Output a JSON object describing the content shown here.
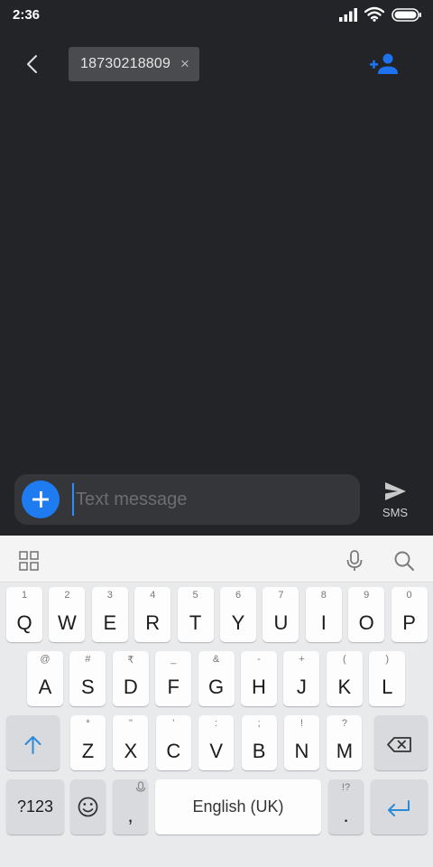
{
  "status_bar": {
    "time": "2:36"
  },
  "header": {
    "recipient": "18730218809"
  },
  "compose": {
    "placeholder": "Text message",
    "send_label": "SMS"
  },
  "keyboard": {
    "row1": [
      {
        "hint": "1",
        "key": "Q"
      },
      {
        "hint": "2",
        "key": "W"
      },
      {
        "hint": "3",
        "key": "E"
      },
      {
        "hint": "4",
        "key": "R"
      },
      {
        "hint": "5",
        "key": "T"
      },
      {
        "hint": "6",
        "key": "Y"
      },
      {
        "hint": "7",
        "key": "U"
      },
      {
        "hint": "8",
        "key": "I"
      },
      {
        "hint": "9",
        "key": "O"
      },
      {
        "hint": "0",
        "key": "P"
      }
    ],
    "row2": [
      {
        "hint": "@",
        "key": "A"
      },
      {
        "hint": "#",
        "key": "S"
      },
      {
        "hint": "₹",
        "key": "D"
      },
      {
        "hint": "_",
        "key": "F"
      },
      {
        "hint": "&",
        "key": "G"
      },
      {
        "hint": "-",
        "key": "H"
      },
      {
        "hint": "+",
        "key": "J"
      },
      {
        "hint": "(",
        "key": "K"
      },
      {
        "hint": ")",
        "key": "L"
      }
    ],
    "row3": [
      {
        "hint": "*",
        "key": "Z"
      },
      {
        "hint": "\"",
        "key": "X"
      },
      {
        "hint": "'",
        "key": "C"
      },
      {
        "hint": ":",
        "key": "V"
      },
      {
        "hint": ";",
        "key": "B"
      },
      {
        "hint": "!",
        "key": "N"
      },
      {
        "hint": "?",
        "key": "M"
      }
    ],
    "symbols_label": "?123",
    "comma": ",",
    "space_label": "English (UK)",
    "period_hint": "!?",
    "period": "."
  }
}
